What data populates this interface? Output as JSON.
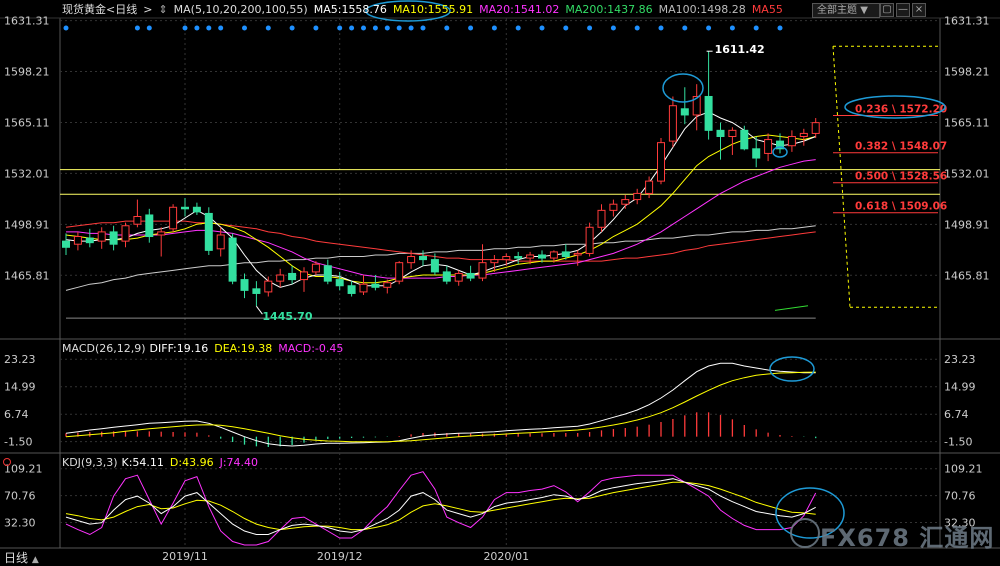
{
  "instrument": "现货黄金",
  "period": "日线",
  "period_button": "日线",
  "theme_button": "全部主题",
  "ma_legend": {
    "params": "MA(5,10,20,200,100,55)",
    "ma5": "MA5:1558.76",
    "ma10": "MA10:1555.91",
    "ma20": "MA20:1541.02",
    "ma200": "MA200:1437.86",
    "ma100": "MA100:1498.28",
    "ma55": "MA55"
  },
  "macd_legend": {
    "params": "MACD(26,12,9)",
    "diff": "DIFF:19.16",
    "dea": "DEA:19.38",
    "macd": "MACD:-0.45"
  },
  "kdj_legend": {
    "params": "KDJ(9,3,3)",
    "k": "K:54.11",
    "d": "D:43.96",
    "j": "J:74.40"
  },
  "watermark": "FX678 汇通网",
  "colors": {
    "up": "#ff3b3b",
    "down": "#33e0a0",
    "ma5": "#ffffff",
    "ma10": "#ffff00",
    "ma20": "#ff33ff",
    "ma200": "#aaaaaa",
    "ma100": "#cccccc",
    "ma55": "#ff3b3b",
    "fib": "#ff3b3b",
    "hline": "#ffff66",
    "highlight": "#1e9bd7",
    "marker": "#1e90ff"
  },
  "chart_data": [
    {
      "type": "candlestick",
      "name": "main",
      "yticks": [
        1631.31,
        1598.21,
        1565.11,
        1532.01,
        1498.91,
        1465.81
      ],
      "ylim": [
        1427,
        1633
      ],
      "xticks": [
        {
          "label": "2019/11",
          "index": 10
        },
        {
          "label": "2019/12",
          "index": 23
        },
        {
          "label": "2020/01",
          "index": 37
        }
      ],
      "high_label": "1611.42",
      "low_label": "1445.70",
      "candles": [
        {
          "o": 1488,
          "h": 1493,
          "l": 1479,
          "c": 1484
        },
        {
          "o": 1486,
          "h": 1494,
          "l": 1482,
          "c": 1491
        },
        {
          "o": 1490,
          "h": 1496,
          "l": 1484,
          "c": 1487
        },
        {
          "o": 1488,
          "h": 1497,
          "l": 1483,
          "c": 1494
        },
        {
          "o": 1494,
          "h": 1498,
          "l": 1482,
          "c": 1486
        },
        {
          "o": 1488,
          "h": 1500,
          "l": 1484,
          "c": 1498
        },
        {
          "o": 1499,
          "h": 1515,
          "l": 1497,
          "c": 1504
        },
        {
          "o": 1505,
          "h": 1509,
          "l": 1487,
          "c": 1491
        },
        {
          "o": 1492,
          "h": 1497,
          "l": 1478,
          "c": 1494
        },
        {
          "o": 1496,
          "h": 1512,
          "l": 1494,
          "c": 1510
        },
        {
          "o": 1510,
          "h": 1516,
          "l": 1504,
          "c": 1509
        },
        {
          "o": 1510,
          "h": 1513,
          "l": 1505,
          "c": 1507
        },
        {
          "o": 1506,
          "h": 1510,
          "l": 1479,
          "c": 1482
        },
        {
          "o": 1483,
          "h": 1497,
          "l": 1478,
          "c": 1492
        },
        {
          "o": 1490,
          "h": 1493,
          "l": 1460,
          "c": 1462
        },
        {
          "o": 1463,
          "h": 1467,
          "l": 1451,
          "c": 1456
        },
        {
          "o": 1457,
          "h": 1462,
          "l": 1445.7,
          "c": 1454
        },
        {
          "o": 1455,
          "h": 1465,
          "l": 1452,
          "c": 1462
        },
        {
          "o": 1462,
          "h": 1470,
          "l": 1458,
          "c": 1466
        },
        {
          "o": 1467,
          "h": 1472,
          "l": 1460,
          "c": 1463
        },
        {
          "o": 1463,
          "h": 1471,
          "l": 1455,
          "c": 1468
        },
        {
          "o": 1468,
          "h": 1475,
          "l": 1466,
          "c": 1473
        },
        {
          "o": 1472,
          "h": 1476,
          "l": 1460,
          "c": 1462
        },
        {
          "o": 1463,
          "h": 1468,
          "l": 1456,
          "c": 1459
        },
        {
          "o": 1459,
          "h": 1462,
          "l": 1452,
          "c": 1454
        },
        {
          "o": 1455,
          "h": 1466,
          "l": 1453,
          "c": 1460
        },
        {
          "o": 1460,
          "h": 1466,
          "l": 1456,
          "c": 1458
        },
        {
          "o": 1458,
          "h": 1463,
          "l": 1454,
          "c": 1461
        },
        {
          "o": 1462,
          "h": 1475,
          "l": 1460,
          "c": 1474
        },
        {
          "o": 1474,
          "h": 1482,
          "l": 1470,
          "c": 1478
        },
        {
          "o": 1478,
          "h": 1482,
          "l": 1472,
          "c": 1476
        },
        {
          "o": 1476,
          "h": 1480,
          "l": 1466,
          "c": 1468
        },
        {
          "o": 1468,
          "h": 1472,
          "l": 1460,
          "c": 1462
        },
        {
          "o": 1462,
          "h": 1469,
          "l": 1459,
          "c": 1467
        },
        {
          "o": 1467,
          "h": 1472,
          "l": 1462,
          "c": 1464
        },
        {
          "o": 1464,
          "h": 1486,
          "l": 1462,
          "c": 1474
        },
        {
          "o": 1474,
          "h": 1479,
          "l": 1468,
          "c": 1476
        },
        {
          "o": 1476,
          "h": 1480,
          "l": 1472,
          "c": 1478
        },
        {
          "o": 1478,
          "h": 1481,
          "l": 1473,
          "c": 1477
        },
        {
          "o": 1477,
          "h": 1481,
          "l": 1473,
          "c": 1479
        },
        {
          "o": 1479,
          "h": 1482,
          "l": 1474,
          "c": 1477
        },
        {
          "o": 1477,
          "h": 1482,
          "l": 1474,
          "c": 1481
        },
        {
          "o": 1481,
          "h": 1486,
          "l": 1476,
          "c": 1478
        },
        {
          "o": 1479,
          "h": 1482,
          "l": 1472,
          "c": 1480
        },
        {
          "o": 1480,
          "h": 1500,
          "l": 1478,
          "c": 1497
        },
        {
          "o": 1497,
          "h": 1512,
          "l": 1494,
          "c": 1508
        },
        {
          "o": 1508,
          "h": 1515,
          "l": 1504,
          "c": 1512
        },
        {
          "o": 1512,
          "h": 1518,
          "l": 1509,
          "c": 1515
        },
        {
          "o": 1515,
          "h": 1522,
          "l": 1512,
          "c": 1519
        },
        {
          "o": 1519,
          "h": 1530,
          "l": 1516,
          "c": 1527
        },
        {
          "o": 1527,
          "h": 1555,
          "l": 1525,
          "c": 1552
        },
        {
          "o": 1553,
          "h": 1582,
          "l": 1549,
          "c": 1576
        },
        {
          "o": 1574,
          "h": 1588,
          "l": 1564,
          "c": 1570
        },
        {
          "o": 1570,
          "h": 1590,
          "l": 1560,
          "c": 1582
        },
        {
          "o": 1582,
          "h": 1611.42,
          "l": 1554,
          "c": 1560
        },
        {
          "o": 1560,
          "h": 1565,
          "l": 1541,
          "c": 1556
        },
        {
          "o": 1556,
          "h": 1562,
          "l": 1544,
          "c": 1560
        },
        {
          "o": 1560,
          "h": 1563,
          "l": 1547,
          "c": 1548
        },
        {
          "o": 1548,
          "h": 1556,
          "l": 1536,
          "c": 1542
        },
        {
          "o": 1545,
          "h": 1558,
          "l": 1540,
          "c": 1554
        },
        {
          "o": 1553,
          "h": 1558,
          "l": 1545,
          "c": 1548
        },
        {
          "o": 1550,
          "h": 1560,
          "l": 1546,
          "c": 1556
        },
        {
          "o": 1556,
          "h": 1561,
          "l": 1550,
          "c": 1558
        },
        {
          "o": 1558,
          "h": 1568,
          "l": 1555,
          "c": 1565
        }
      ],
      "hlines": [
        1534.5,
        1518.5
      ],
      "fib_levels": [
        {
          "label": "0.236 \\ 1572.20",
          "value": 1572.2
        },
        {
          "label": "0.382 \\ 1548.07",
          "value": 1548.07
        },
        {
          "label": "0.500 \\ 1528.56",
          "value": 1528.56
        },
        {
          "label": "0.618 \\ 1509.06",
          "value": 1509.06
        }
      ],
      "ma5": [
        1489,
        1488,
        1488,
        1489,
        1489,
        1490,
        1493,
        1495,
        1496,
        1498,
        1503,
        1508,
        1504,
        1497,
        1490,
        1479,
        1469,
        1462,
        1458,
        1460,
        1464,
        1466,
        1466,
        1465,
        1462,
        1459,
        1459,
        1459,
        1463,
        1468,
        1472,
        1473,
        1472,
        1469,
        1466,
        1468,
        1471,
        1473,
        1476,
        1478,
        1478,
        1479,
        1480,
        1482,
        1487,
        1494,
        1502,
        1511,
        1516,
        1526,
        1537,
        1549,
        1561,
        1569,
        1572,
        1568,
        1565,
        1560,
        1554,
        1552,
        1550,
        1551,
        1553,
        1556
      ],
      "ma10": [
        1492,
        1491,
        1490,
        1489,
        1489,
        1489,
        1490,
        1492,
        1493,
        1494,
        1496,
        1499,
        1500,
        1499,
        1497,
        1494,
        1489,
        1484,
        1478,
        1472,
        1467,
        1465,
        1465,
        1464,
        1462,
        1461,
        1461,
        1462,
        1464,
        1465,
        1466,
        1466,
        1466,
        1466,
        1466,
        1467,
        1469,
        1471,
        1473,
        1474,
        1475,
        1475,
        1477,
        1479,
        1482,
        1486,
        1491,
        1495,
        1499,
        1505,
        1511,
        1519,
        1528,
        1537,
        1543,
        1547,
        1551,
        1554,
        1556,
        1557,
        1556,
        1555,
        1554,
        1556
      ],
      "ma20": [
        1494,
        1494,
        1493,
        1493,
        1492,
        1492,
        1492,
        1492,
        1492,
        1493,
        1494,
        1495,
        1495,
        1494,
        1493,
        1491,
        1489,
        1487,
        1484,
        1481,
        1477,
        1474,
        1472,
        1470,
        1468,
        1466,
        1465,
        1464,
        1464,
        1464,
        1464,
        1464,
        1465,
        1465,
        1466,
        1466,
        1467,
        1468,
        1469,
        1470,
        1471,
        1472,
        1473,
        1474,
        1476,
        1478,
        1480,
        1483,
        1486,
        1490,
        1494,
        1499,
        1504,
        1509,
        1514,
        1519,
        1523,
        1527,
        1530,
        1533,
        1536,
        1538,
        1540,
        1541
      ],
      "ma55": [
        1497,
        1498,
        1499,
        1500,
        1500,
        1501,
        1501,
        1501,
        1501,
        1501,
        1501,
        1500,
        1500,
        1499,
        1498,
        1497,
        1496,
        1494,
        1493,
        1491,
        1490,
        1488,
        1487,
        1486,
        1485,
        1484,
        1483,
        1482,
        1481,
        1480,
        1479,
        1478,
        1477,
        1477,
        1476,
        1476,
        1476,
        1476,
        1475,
        1475,
        1475,
        1475,
        1475,
        1475,
        1475,
        1475,
        1476,
        1477,
        1477,
        1478,
        1479,
        1480,
        1482,
        1483,
        1485,
        1486,
        1487,
        1488,
        1489,
        1490,
        1491,
        1492,
        1493,
        1494
      ],
      "ma100": [
        1456,
        1458,
        1460,
        1461,
        1463,
        1464,
        1466,
        1467,
        1468,
        1469,
        1470,
        1471,
        1472,
        1472,
        1473,
        1474,
        1474,
        1475,
        1475,
        1476,
        1476,
        1477,
        1477,
        1478,
        1478,
        1478,
        1479,
        1479,
        1480,
        1480,
        1480,
        1481,
        1481,
        1482,
        1482,
        1482,
        1483,
        1483,
        1484,
        1484,
        1485,
        1485,
        1486,
        1486,
        1486,
        1487,
        1487,
        1488,
        1488,
        1489,
        1490,
        1490,
        1491,
        1492,
        1492,
        1493,
        1494,
        1494,
        1495,
        1495,
        1496,
        1496,
        1497,
        1498
      ],
      "ma200": [
        1438,
        1438,
        1438,
        1438,
        1438,
        1438,
        1438,
        1438,
        1438,
        1438,
        1438,
        1438,
        1438,
        1438,
        1438,
        1438,
        1438,
        1438,
        1438,
        1438,
        1438,
        1438,
        1438,
        1438,
        1438,
        1438,
        1438,
        1438,
        1438,
        1438,
        1438,
        1438,
        1438,
        1438,
        1438,
        1438,
        1438,
        1438,
        1438,
        1438,
        1438,
        1438,
        1438,
        1438,
        1438,
        1438,
        1438,
        1438,
        1438,
        1438,
        1438,
        1438,
        1438,
        1438,
        1438,
        1438,
        1438,
        1438,
        1438,
        1438,
        1438,
        1438,
        1438,
        1438
      ]
    },
    {
      "type": "bar",
      "name": "macd",
      "yticks": [
        23.23,
        14.99,
        6.74,
        -1.5
      ],
      "ylim": [
        -4,
        26
      ],
      "diff": [
        1,
        1.5,
        2,
        2.4,
        2.8,
        3.2,
        3.6,
        4,
        4.2,
        4.4,
        4.6,
        4.7,
        4,
        2.8,
        1.4,
        0,
        -1.2,
        -2.1,
        -2.6,
        -2.8,
        -2.6,
        -2.2,
        -2,
        -2,
        -1.9,
        -1.8,
        -1.7,
        -1.6,
        -1.2,
        -0.5,
        0.2,
        0.6,
        0.8,
        1,
        1.1,
        1.3,
        1.5,
        1.8,
        2,
        2.2,
        2.4,
        2.7,
        2.9,
        3.1,
        3.8,
        4.8,
        5.8,
        6.8,
        8,
        9.6,
        11.6,
        14,
        16.8,
        19.5,
        21.2,
        22,
        22,
        21.2,
        20.6,
        20,
        19.6,
        19.4,
        19.2,
        19.16
      ],
      "dea": [
        0,
        0.3,
        0.6,
        0.9,
        1.2,
        1.6,
        2,
        2.4,
        2.7,
        3,
        3.3,
        3.5,
        3.6,
        3.4,
        3,
        2.4,
        1.7,
        1,
        0.3,
        -0.3,
        -0.8,
        -1.1,
        -1.3,
        -1.4,
        -1.5,
        -1.5,
        -1.5,
        -1.5,
        -1.4,
        -1.2,
        -0.9,
        -0.6,
        -0.3,
        0,
        0.2,
        0.4,
        0.6,
        0.8,
        1,
        1.2,
        1.4,
        1.6,
        1.8,
        2,
        2.4,
        2.9,
        3.5,
        4.2,
        5,
        6,
        7.2,
        8.7,
        10.4,
        12.2,
        13.9,
        15.5,
        16.8,
        17.7,
        18.4,
        18.8,
        19.1,
        19.2,
        19.3,
        19.38
      ],
      "hist": [
        1,
        1.2,
        1.4,
        1.5,
        1.6,
        1.6,
        1.6,
        1.6,
        1.5,
        1.4,
        1.3,
        1.2,
        0.4,
        -0.6,
        -1.6,
        -2.4,
        -2.9,
        -3.1,
        -2.9,
        -2.5,
        -1.8,
        -1.1,
        -0.7,
        -0.6,
        -0.4,
        -0.3,
        -0.2,
        -0.1,
        0.2,
        0.7,
        1.1,
        1.2,
        1.1,
        1,
        0.9,
        0.9,
        0.9,
        1,
        1,
        1,
        1,
        1.1,
        1.1,
        1.1,
        1.4,
        1.9,
        2.3,
        2.6,
        3,
        3.6,
        4.4,
        5.3,
        6.4,
        7.3,
        7.3,
        6.5,
        5.2,
        3.5,
        2.2,
        1.2,
        0.5,
        0.2,
        -0.1,
        -0.45
      ]
    },
    {
      "type": "line",
      "name": "kdj",
      "yticks": [
        109.21,
        70.76,
        32.3
      ],
      "ylim": [
        0,
        116
      ],
      "k": [
        40,
        35,
        30,
        32,
        50,
        65,
        70,
        60,
        45,
        55,
        70,
        75,
        60,
        45,
        30,
        20,
        15,
        15,
        22,
        28,
        30,
        28,
        25,
        20,
        18,
        22,
        30,
        38,
        50,
        70,
        75,
        65,
        50,
        45,
        40,
        45,
        55,
        60,
        62,
        65,
        68,
        72,
        70,
        65,
        70,
        78,
        82,
        85,
        88,
        90,
        92,
        95,
        90,
        85,
        80,
        70,
        62,
        55,
        48,
        45,
        42,
        40,
        45,
        54
      ],
      "d": [
        45,
        42,
        38,
        36,
        40,
        48,
        55,
        58,
        52,
        53,
        59,
        64,
        63,
        57,
        48,
        38,
        30,
        25,
        22,
        24,
        26,
        27,
        27,
        25,
        22,
        22,
        25,
        29,
        36,
        47,
        56,
        59,
        56,
        52,
        48,
        47,
        50,
        53,
        56,
        59,
        62,
        65,
        67,
        66,
        67,
        71,
        75,
        78,
        81,
        84,
        87,
        90,
        90,
        88,
        85,
        80,
        74,
        68,
        61,
        56,
        51,
        47,
        46,
        43.96
      ],
      "j": [
        30,
        22,
        15,
        25,
        70,
        95,
        100,
        65,
        30,
        60,
        92,
        98,
        55,
        20,
        5,
        0,
        0,
        5,
        22,
        38,
        40,
        30,
        20,
        10,
        10,
        22,
        40,
        55,
        78,
        100,
        105,
        80,
        40,
        32,
        25,
        40,
        65,
        75,
        75,
        78,
        80,
        85,
        76,
        62,
        76,
        92,
        96,
        98,
        100,
        100,
        100,
        100,
        90,
        80,
        70,
        50,
        38,
        28,
        22,
        22,
        22,
        25,
        42,
        74.4
      ]
    }
  ]
}
